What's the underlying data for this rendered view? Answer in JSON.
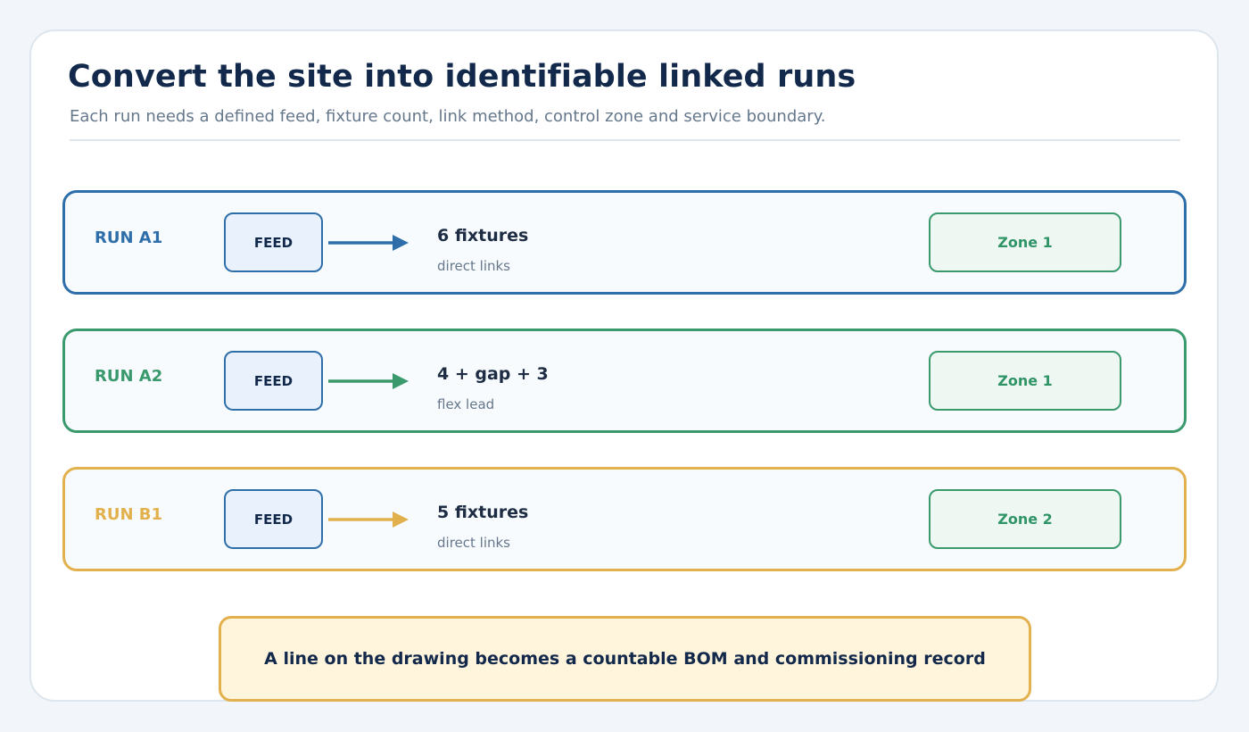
{
  "header": {
    "title": "Convert the site into identifiable linked runs",
    "subtitle": "Each run needs a defined feed, fixture count, link method, control zone and service boundary."
  },
  "runs": [
    {
      "label": "RUN A1",
      "color": "#2e6ea9",
      "feed": "FEED",
      "count": "6 fixtures",
      "method": "direct links",
      "zone": "Zone 1"
    },
    {
      "label": "RUN A2",
      "color": "#3a9a6e",
      "feed": "FEED",
      "count": "4 + gap + 3",
      "method": "flex lead",
      "zone": "Zone 1"
    },
    {
      "label": "RUN B1",
      "color": "#e2b14e",
      "feed": "FEED",
      "count": "5 fixtures",
      "method": "direct links",
      "zone": "Zone 2"
    }
  ],
  "footer": {
    "note": "A line on the drawing becomes a countable BOM and commissioning record"
  }
}
